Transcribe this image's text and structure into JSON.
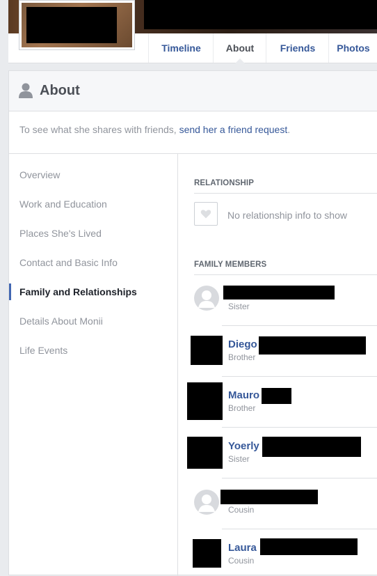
{
  "tabs": [
    {
      "label": "Timeline"
    },
    {
      "label": "About"
    },
    {
      "label": "Friends"
    },
    {
      "label": "Photos"
    }
  ],
  "about": {
    "title": "About",
    "notice_prefix": "To see what she shares with friends,",
    "notice_link": "send her a friend request",
    "notice_suffix": "."
  },
  "sidebar": {
    "items": [
      {
        "label": "Overview"
      },
      {
        "label": "Work and Education"
      },
      {
        "label": "Places She's Lived"
      },
      {
        "label": "Contact and Basic Info"
      },
      {
        "label": "Family and Relationships"
      },
      {
        "label": "Details About Monii"
      },
      {
        "label": "Life Events"
      }
    ]
  },
  "relationship": {
    "header": "RELATIONSHIP",
    "empty_text": "No relationship info to show",
    "icon": "heart-icon"
  },
  "family": {
    "header": "FAMILY MEMBERS",
    "members": [
      {
        "name": "",
        "relation": "Sister",
        "avatar": "default"
      },
      {
        "name": "Diego",
        "relation": "Brother",
        "avatar": "photo"
      },
      {
        "name": "Mauro",
        "relation": "Brother",
        "avatar": "photo"
      },
      {
        "name": "Yoerly",
        "relation": "Sister",
        "avatar": "photo"
      },
      {
        "name": "",
        "relation": "Cousin",
        "avatar": "default"
      },
      {
        "name": "Laura",
        "relation": "Cousin",
        "avatar": "photo"
      }
    ]
  },
  "colors": {
    "link": "#365899",
    "muted": "#90949c",
    "accent": "#4267b2",
    "page_bg": "#e9ebee"
  }
}
